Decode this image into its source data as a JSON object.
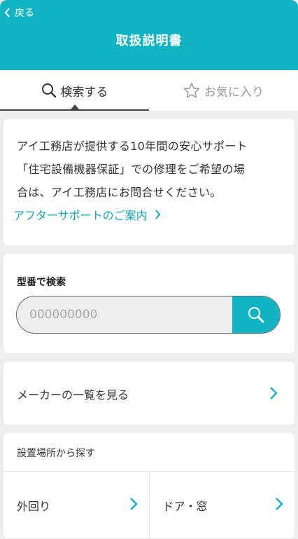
{
  "header": {
    "back_label": "戻る",
    "title": "取扱説明書"
  },
  "tabs": [
    {
      "label": "検索する",
      "icon": "search-icon",
      "active": true
    },
    {
      "label": "お気に入り",
      "icon": "star-icon",
      "active": false
    }
  ],
  "notice": {
    "lines": [
      "アイ工務店が提供する10年間の安心サポート",
      "「住宅設備機器保証」での修理をご希望の場",
      "合は、アイ工務店にお問合せください。"
    ],
    "link_label": "アフターサポートのご案内"
  },
  "search": {
    "label": "型番で検索",
    "placeholder": "000000000",
    "button_icon": "search-icon"
  },
  "maker": {
    "label": "メーカーの一覧を見る"
  },
  "location": {
    "title": "設置場所から探す",
    "items": [
      {
        "label": "外回り"
      },
      {
        "label": "ドア・窓"
      }
    ]
  },
  "colors": {
    "accent": "#12b3c3",
    "link": "#12a8b8",
    "background": "#eeeeee"
  }
}
